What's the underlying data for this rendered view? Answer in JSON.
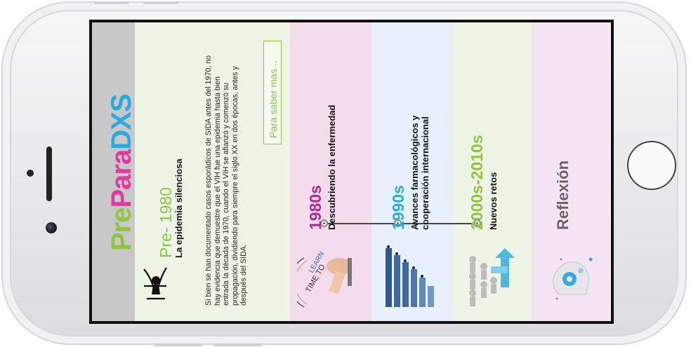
{
  "logo": {
    "part1": "Pre",
    "part2": "Para",
    "part3": "DXS"
  },
  "pre_1980": {
    "year": "Pre- 1980",
    "subtitle": "La epidemia silenciosa",
    "body": "Si bien se han documentado casos esporádicos de SIDA antes del 1970, no hay evidencia que demuestre que el VIH fue una epidemia hasta bien entrada la década de 1970, cuando el VIH se afianzó y comenzó su propagación,  dividiendo para siempre el siglo XX en dos épocas, antes y después del SIDA.",
    "more_button": "Para saber mas..."
  },
  "era_1980": {
    "year": "1980s",
    "title": "Descubriendo la enfermedad"
  },
  "era_1990": {
    "year": "1990s",
    "title_line1": "Avances farmacológicos y",
    "title_line2": "cooperación internacional"
  },
  "era_2000": {
    "year": "2000s-2010s",
    "title": "Nuevos retos"
  },
  "reflection": {
    "title": "Reflexión"
  },
  "colors": {
    "green": "#8cc63f",
    "magenta": "#e03aa0",
    "blue": "#29abe2",
    "purple": "#b0279b"
  }
}
